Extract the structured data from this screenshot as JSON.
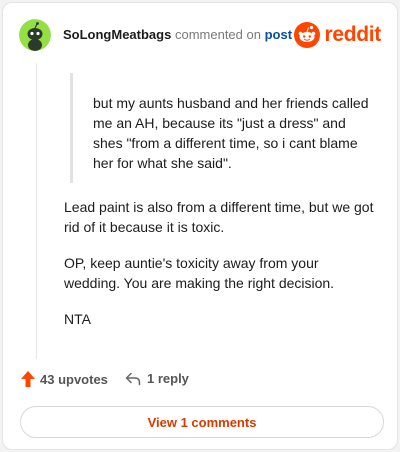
{
  "header": {
    "username": "SoLongMeatbags",
    "action_text": "commented on",
    "post_link": "post",
    "brand": "reddit",
    "avatar_icon": "snoo-avatar-icon",
    "logo_icon": "reddit-logo-icon"
  },
  "comment": {
    "quote": "but my aunts husband and her friends called me an AH, because its \"just a dress\" and shes \"from a different time, so i cant blame her for what she said\".",
    "paragraphs": [
      "Lead paint is also from a different time, but we got rid of it because it is toxic.",
      "OP, keep auntie's toxicity away from your wedding. You are making the right decision.",
      "NTA"
    ]
  },
  "actions": {
    "upvotes": "43 upvotes",
    "replies": "1 reply",
    "upvote_icon": "upvote-arrow-icon",
    "reply_icon": "reply-arrow-icon"
  },
  "footer": {
    "view_comments": "View 1 comments"
  },
  "colors": {
    "brand": "#ff4500",
    "link": "#0a4f9e",
    "avatar_bg": "#94e044"
  }
}
